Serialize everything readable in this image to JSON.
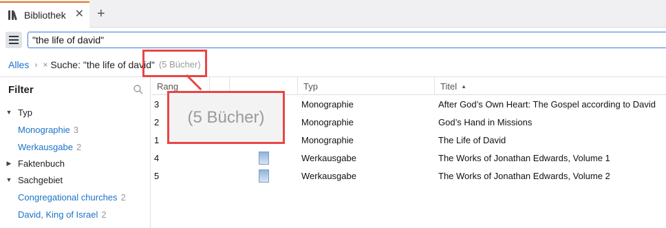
{
  "tab": {
    "title": "Bibliothek",
    "close": "✕",
    "new_tab": "+"
  },
  "search": {
    "value": "\"the life of david\""
  },
  "breadcrumb": {
    "all": "Alles",
    "separator": "›",
    "remove": "×",
    "search_label": "Suche: \"the life of david\"",
    "count": "(5 Bücher)"
  },
  "sidebar": {
    "title": "Filter",
    "items": [
      {
        "kind": "group",
        "label": "Typ",
        "expanded": true
      },
      {
        "kind": "value",
        "label": "Monographie",
        "count": "3"
      },
      {
        "kind": "value",
        "label": "Werkausgabe",
        "count": "2"
      },
      {
        "kind": "group",
        "label": "Faktenbuch",
        "expanded": false
      },
      {
        "kind": "group",
        "label": "Sachgebiet",
        "expanded": true
      },
      {
        "kind": "value",
        "label": "Congregational churches",
        "count": "2"
      },
      {
        "kind": "value",
        "label": "David, King of Israel",
        "count": "2"
      }
    ]
  },
  "table": {
    "columns": {
      "rank": "Rang",
      "type": "Typ",
      "title": "Titel"
    },
    "rows": [
      {
        "rank": "3",
        "type": "Monographie",
        "title": "After God’s Own Heart: The Gospel according to David"
      },
      {
        "rank": "2",
        "type": "Monographie",
        "title": "God’s Hand in Missions"
      },
      {
        "rank": "1",
        "type": "Monographie",
        "title": "The Life of David"
      },
      {
        "rank": "4",
        "type": "Werkausgabe",
        "title": "The Works of Jonathan Edwards, Volume 1"
      },
      {
        "rank": "5",
        "type": "Werkausgabe",
        "title": "The Works of Jonathan Edwards, Volume 2"
      }
    ]
  },
  "callout": {
    "text": "(5 Bücher)"
  },
  "colors": {
    "accent_tab": "#e8731c",
    "link": "#1a73c7",
    "highlight": "#e84545"
  }
}
